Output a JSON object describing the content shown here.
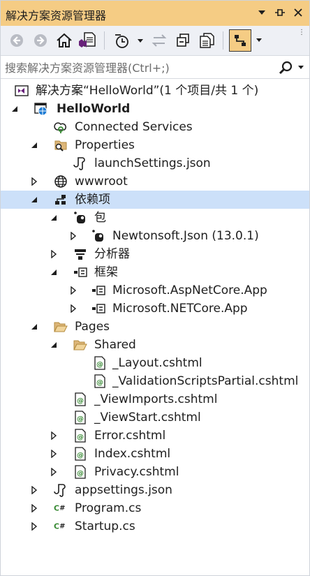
{
  "window": {
    "title": "解决方案资源管理器"
  },
  "search": {
    "placeholder": "搜索解决方案资源管理器(Ctrl+;)"
  },
  "colors": {
    "title_bar": "#f5cc84",
    "toolbar": "#eef0f5",
    "selection": "#cce0f9",
    "accent_purple": "#68217a",
    "accent_green": "#388a34",
    "folder": "#dcb67a"
  },
  "tree": {
    "solution": "解决方案“HelloWorld”(1 个项目/共 1 个)",
    "project": "HelloWorld",
    "connected_services": "Connected Services",
    "properties": "Properties",
    "launch_settings": "launchSettings.json",
    "wwwroot": "wwwroot",
    "dependencies": "依赖项",
    "packages": "包",
    "newtonsoft": "Newtonsoft.Json (13.0.1)",
    "analyzers": "分析器",
    "frameworks": "框架",
    "aspnetcore_app": "Microsoft.AspNetCore.App",
    "netcore_app": "Microsoft.NETCore.App",
    "pages": "Pages",
    "shared": "Shared",
    "layout": "_Layout.cshtml",
    "validation": "_ValidationScriptsPartial.cshtml",
    "viewimports": "_ViewImports.cshtml",
    "viewstart": "_ViewStart.cshtml",
    "error": "Error.cshtml",
    "index": "Index.cshtml",
    "privacy": "Privacy.cshtml",
    "appsettings": "appsettings.json",
    "program": "Program.cs",
    "startup": "Startup.cs"
  }
}
